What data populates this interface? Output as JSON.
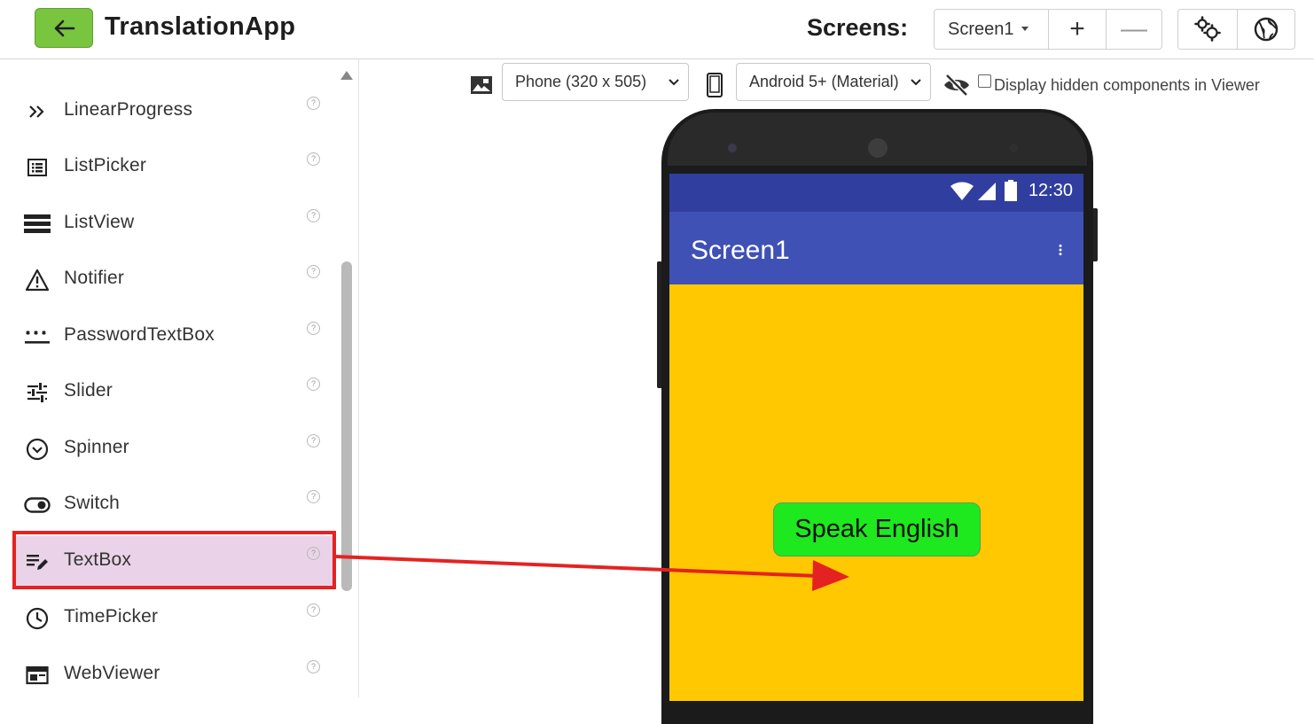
{
  "header": {
    "app_title": "TranslationApp",
    "screens_label": "Screens:",
    "screen_selected": "Screen1",
    "add_label": "+",
    "remove_label": "—"
  },
  "palette": {
    "items": [
      {
        "label": "LinearProgress",
        "icon": "double-chevron-right-icon"
      },
      {
        "label": "ListPicker",
        "icon": "list-picker-icon"
      },
      {
        "label": "ListView",
        "icon": "list-view-icon"
      },
      {
        "label": "Notifier",
        "icon": "warning-icon"
      },
      {
        "label": "PasswordTextBox",
        "icon": "password-icon"
      },
      {
        "label": "Slider",
        "icon": "slider-icon"
      },
      {
        "label": "Spinner",
        "icon": "chevron-circle-icon"
      },
      {
        "label": "Switch",
        "icon": "toggle-icon"
      },
      {
        "label": "TextBox",
        "icon": "text-edit-icon"
      },
      {
        "label": "TimePicker",
        "icon": "clock-icon"
      },
      {
        "label": "WebViewer",
        "icon": "browser-window-icon"
      }
    ],
    "help_glyph": "?",
    "selected_item": "TextBox"
  },
  "viewer": {
    "device_select": "Phone (320 x 505)",
    "theme_select": "Android 5+ (Material)",
    "hidden_components_label": "Display hidden components in Viewer"
  },
  "phone": {
    "status_time": "12:30",
    "screen_title": "Screen1",
    "button_text": "Speak English"
  },
  "colors": {
    "accent_green": "#79c540",
    "status_bar": "#303f9f",
    "app_bar": "#3f51b5",
    "canvas": "#ffc800",
    "button": "#1ee81e",
    "highlight_red": "#e52222",
    "selected_bg": "#ead3e8"
  }
}
